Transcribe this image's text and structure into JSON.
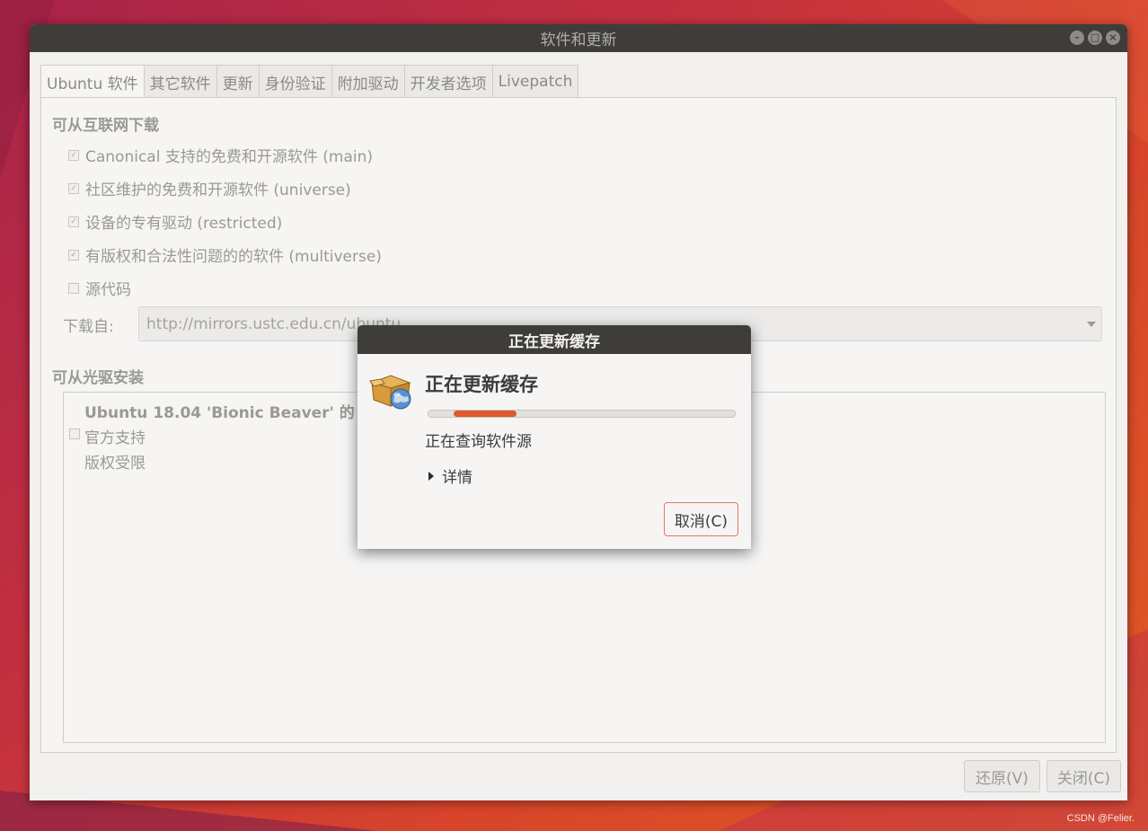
{
  "window": {
    "title": "软件和更新",
    "controls": [
      "minimize-icon",
      "maximize-icon",
      "close-icon"
    ]
  },
  "tabs": [
    {
      "label": "Ubuntu 软件",
      "active": true
    },
    {
      "label": "其它软件",
      "active": false
    },
    {
      "label": "更新",
      "active": false
    },
    {
      "label": "身份验证",
      "active": false
    },
    {
      "label": "附加驱动",
      "active": false
    },
    {
      "label": "开发者选项",
      "active": false
    },
    {
      "label": "Livepatch",
      "active": false
    }
  ],
  "internet": {
    "title": "可从互联网下载",
    "items": [
      {
        "label": "Canonical 支持的免费和开源软件 (main)",
        "checked": true
      },
      {
        "label": "社区维护的免费和开源软件 (universe)",
        "checked": true
      },
      {
        "label": "设备的专有驱动 (restricted)",
        "checked": true
      },
      {
        "label": "有版权和合法性问题的的软件 (multiverse)",
        "checked": true
      },
      {
        "label": "源代码",
        "checked": false
      }
    ],
    "download_from_label": "下载自:",
    "download_from_value": "http://mirrors.ustc.edu.cn/ubuntu"
  },
  "cdrom": {
    "title": "可从光驱安装",
    "disc_title": "Ubuntu 18.04 'Bionic Beaver' 的 CD",
    "line1": "官方支持",
    "line2": "版权受限",
    "checked": false
  },
  "buttons": {
    "revert": "还原(V)",
    "close": "关闭(C)"
  },
  "dialog": {
    "title": "正在更新缓存",
    "heading": "正在更新缓存",
    "status": "正在查询软件源",
    "details": "详情",
    "cancel": "取消(C)",
    "icon": "package-globe-icon",
    "accent": "#e05a2b"
  },
  "watermark": "CSDN @Felier."
}
